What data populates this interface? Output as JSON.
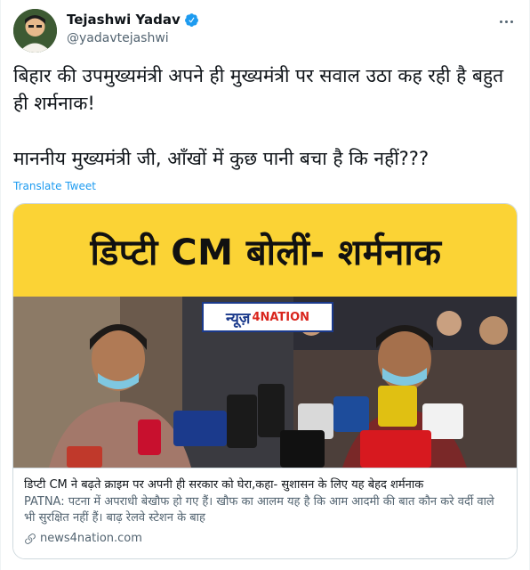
{
  "author": {
    "display_name": "Tejashwi Yadav",
    "handle": "@yadavtejashwi",
    "verified": true
  },
  "tweet": {
    "text": "बिहार की उपमुख्यमंत्री अपने ही मुख्यमंत्री पर सवाल उठा कह रही है बहुत ही शर्मनाक!\n\nमाननीय मुख्यमंत्री जी, आँखों में कुछ पानी बचा है कि नहीं???",
    "translate_label": "Translate Tweet"
  },
  "card": {
    "banner_text": "डिप्टी CM बोलीं- शर्मनाक",
    "logo_text": "न्यूज़",
    "logo_num": "4NATION",
    "title": "डिप्टी CM ने बढ़ते क्राइम पर अपनी ही सरकार को घेरा,कहा- सुशासन के लिए यह बेहद शर्मनाक",
    "description": "PATNA: पटना में अपराधी बेखौफ हो गए हैं। खौफ का आलम यह है कि आम आदमी की बात कौन करे वर्दी वाले भी सुरक्षित नहीं हैं। बाढ़ रेलवे स्टेशन के बाह",
    "domain": "news4nation.com"
  },
  "icons": {
    "verified": "verified-badge-icon",
    "more": "more-options-icon",
    "link": "link-icon"
  },
  "colors": {
    "link": "#1d9bf0",
    "banner": "#fbd335",
    "secondary_text": "#536471"
  }
}
